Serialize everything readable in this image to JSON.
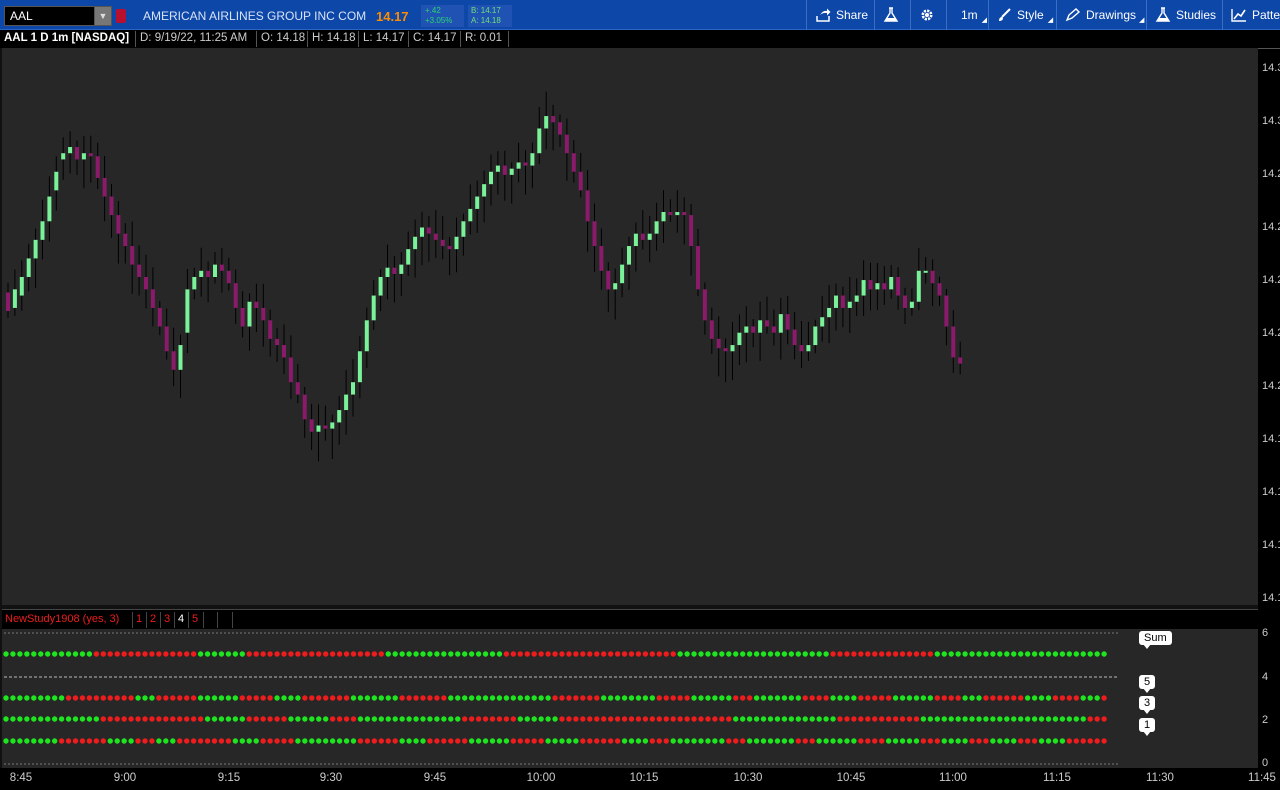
{
  "toolbar": {
    "symbol": "AAL",
    "company": "AMERICAN AIRLINES GROUP INC COM",
    "last_price": "14.17",
    "change": "+.42",
    "change_pct": "+3.05%",
    "bid": "B: 14.17",
    "ask": "A: 14.18",
    "share_label": "Share",
    "timeframe_label": "1m",
    "style_label": "Style",
    "drawings_label": "Drawings",
    "studies_label": "Studies",
    "patterns_label": "Patte"
  },
  "chart_header": {
    "title": "AAL 1 D 1m [NASDAQ]",
    "date": "D: 9/19/22, 11:25 AM",
    "open": "O: 14.18",
    "high": "H: 14.18",
    "low": "L: 14.17",
    "close": "C: 14.17",
    "range": "R: 0.01"
  },
  "price_axis_labels": [
    "14.3",
    "14.3",
    "14.2",
    "14.2",
    "14.2",
    "14.2",
    "14.2",
    "14.1",
    "14.1",
    "14.1",
    "14.1"
  ],
  "lower_axis_labels": [
    "6",
    "4",
    "2",
    "0"
  ],
  "study": {
    "name": "NewStudy1908 (yes, 3)",
    "plots": [
      "1",
      "2",
      "3",
      "4",
      "5"
    ],
    "labels": {
      "sum": "Sum",
      "five": "5",
      "three": "3",
      "one": "1"
    }
  },
  "time_labels": [
    "8:45",
    "9:00",
    "9:15",
    "9:30",
    "9:45",
    "10:00",
    "10:15",
    "10:30",
    "10:45",
    "11:00",
    "11:15",
    "11:30",
    "11:45"
  ],
  "colors": {
    "up": "#7af29a",
    "down": "#8b1a6b",
    "dot_up": "#1ee61e",
    "dot_down": "#ee1c1c",
    "wick": "#000000"
  },
  "chart_data": {
    "type": "candlestick",
    "start_time": "8:45",
    "interval": "1m",
    "closes": [
      14.225,
      14.232,
      14.236,
      14.242,
      14.248,
      14.254,
      14.262,
      14.27,
      14.276,
      14.278,
      14.274,
      14.276,
      14.275,
      14.268,
      14.262,
      14.256,
      14.25,
      14.246,
      14.24,
      14.236,
      14.232,
      14.226,
      14.22,
      14.212,
      14.206,
      14.214,
      14.232,
      14.236,
      14.238,
      14.236,
      14.24,
      14.238,
      14.234,
      14.226,
      14.22,
      14.228,
      14.226,
      14.222,
      14.216,
      14.214,
      14.21,
      14.202,
      14.198,
      14.19,
      14.186,
      14.188,
      14.187,
      14.189,
      14.193,
      14.198,
      14.202,
      14.212,
      14.222,
      14.23,
      14.236,
      14.239,
      14.237,
      14.24,
      14.245,
      14.249,
      14.252,
      14.25,
      14.248,
      14.246,
      14.245,
      14.249,
      14.254,
      14.258,
      14.262,
      14.266,
      14.27,
      14.272,
      14.269,
      14.271,
      14.273,
      14.272,
      14.276,
      14.284,
      14.288,
      14.286,
      14.282,
      14.276,
      14.27,
      14.264,
      14.254,
      14.246,
      14.238,
      14.232,
      14.234,
      14.24,
      14.246,
      14.25,
      14.248,
      14.25,
      14.254,
      14.257,
      14.256,
      14.257,
      14.256,
      14.246,
      14.232,
      14.222,
      14.216,
      14.213,
      14.212,
      14.214,
      14.218,
      14.22,
      14.218,
      14.222,
      14.22,
      14.218,
      14.224,
      14.219,
      14.214,
      14.212,
      14.214,
      14.22,
      14.223,
      14.226,
      14.23,
      14.226,
      14.228,
      14.23,
      14.235,
      14.232,
      14.234,
      14.232,
      14.236,
      14.23,
      14.226,
      14.228,
      14.238,
      14.238,
      14.234,
      14.23,
      14.22,
      14.21,
      14.208
    ],
    "open_to_close": [
      -0.006,
      0.006,
      0.006,
      0.006,
      0.006,
      0.006,
      0.008,
      0.006,
      0.002,
      0.002,
      -0.004,
      0.002,
      -0.001,
      -0.007,
      -0.006,
      -0.006,
      -0.006,
      -0.004,
      -0.006,
      -0.004,
      -0.004,
      -0.006,
      -0.006,
      -0.008,
      -0.006,
      0.008,
      0.014,
      0.004,
      0.002,
      -0.002,
      0.004,
      -0.002,
      -0.004,
      -0.008,
      -0.006,
      0.008,
      -0.002,
      -0.004,
      -0.006,
      -0.002,
      -0.004,
      -0.008,
      -0.004,
      -0.008,
      -0.004,
      0.002,
      -0.001,
      0.002,
      0.004,
      0.005,
      0.004,
      0.01,
      0.01,
      0.008,
      0.006,
      0.003,
      -0.002,
      0.003,
      0.005,
      0.004,
      0.003,
      -0.002,
      -0.002,
      -0.002,
      -0.001,
      0.004,
      0.005,
      0.004,
      0.004,
      0.004,
      0.004,
      0.002,
      -0.003,
      0.002,
      0.002,
      -0.001,
      0.004,
      0.008,
      0.004,
      -0.002,
      -0.004,
      -0.006,
      -0.006,
      -0.006,
      -0.01,
      -0.008,
      -0.008,
      -0.006,
      0.002,
      0.006,
      0.006,
      0.004,
      -0.002,
      0.002,
      0.004,
      0.003,
      -0.001,
      0.001,
      -0.001,
      -0.01,
      -0.014,
      -0.01,
      -0.006,
      -0.003,
      -0.001,
      0.002,
      0.004,
      0.002,
      -0.002,
      0.004,
      -0.002,
      -0.002,
      0.006,
      -0.005,
      -0.005,
      -0.002,
      0.002,
      0.006,
      0.003,
      0.003,
      0.004,
      -0.004,
      0.002,
      0.002,
      0.005,
      -0.003,
      0.002,
      -0.002,
      0.004,
      -0.006,
      -0.004,
      0.002,
      0.01,
      0.0,
      -0.004,
      -0.004,
      -0.01,
      -0.01,
      -0.002
    ],
    "y_range": [
      14.13,
      14.31
    ],
    "x_range": [
      "8:45",
      "11:45"
    ],
    "y_ticks_shown": [
      "14.3",
      "14.2",
      "14.1"
    ],
    "dots_rows": [
      {
        "name": "Sum",
        "value": 5
      },
      {
        "name": "5",
        "value": 3
      },
      {
        "name": "3",
        "value": 2
      },
      {
        "name": "1",
        "value": 1
      }
    ]
  }
}
